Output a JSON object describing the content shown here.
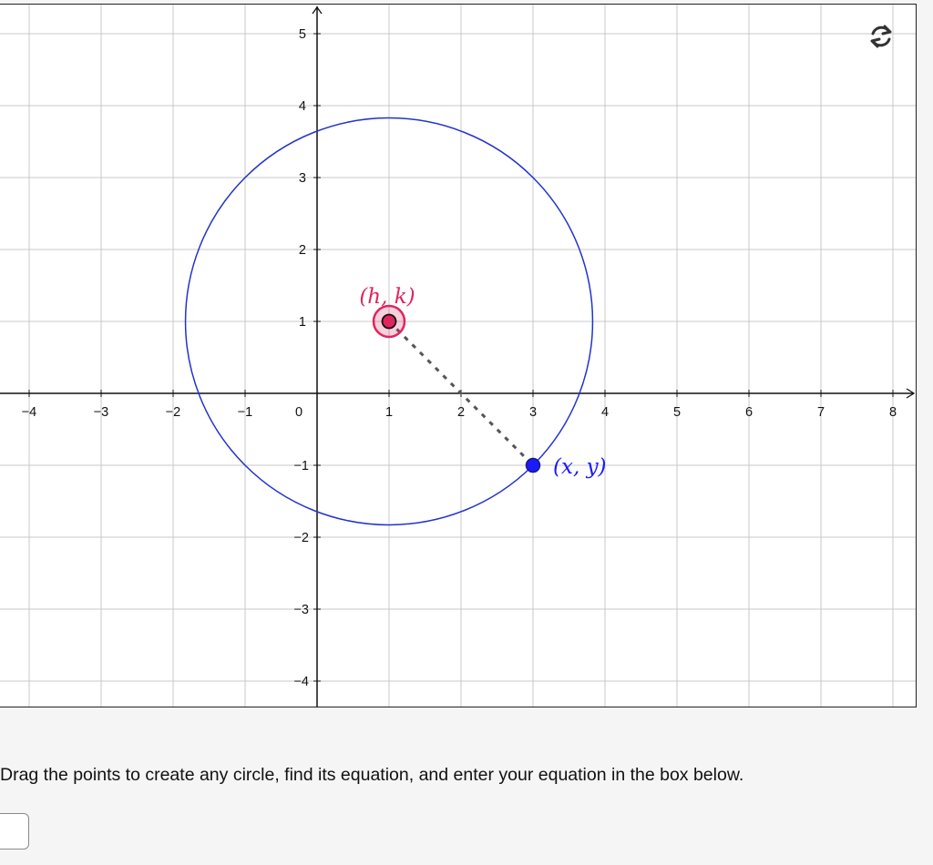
{
  "graph": {
    "x_range": [
      -4,
      8
    ],
    "y_range": [
      -4,
      5
    ],
    "x_tick_labels": [
      "−4",
      "−3",
      "−2",
      "−1",
      "0",
      "1",
      "2",
      "3",
      "4",
      "5",
      "6",
      "7",
      "8"
    ],
    "y_tick_labels_positive": [
      "1",
      "2",
      "3",
      "4",
      "5"
    ],
    "y_tick_labels_negative": [
      "−1",
      "−2",
      "−3",
      "−4"
    ],
    "grid": true,
    "center_point": {
      "label": "(h, k)",
      "x": 1,
      "y": 1,
      "color": "#e0245e"
    },
    "circle_point": {
      "label": "(x, y)",
      "x": 3,
      "y": -1,
      "color": "#1a1aff"
    },
    "circle_color": "#2233cc",
    "radius_segment_style": "dashed"
  },
  "reset_button": {
    "icon": "refresh-icon"
  },
  "instructions": "Drag the points to create any circle, find its equation, and enter your equation in the box below.",
  "answer_input": {
    "value": "",
    "placeholder": ""
  }
}
